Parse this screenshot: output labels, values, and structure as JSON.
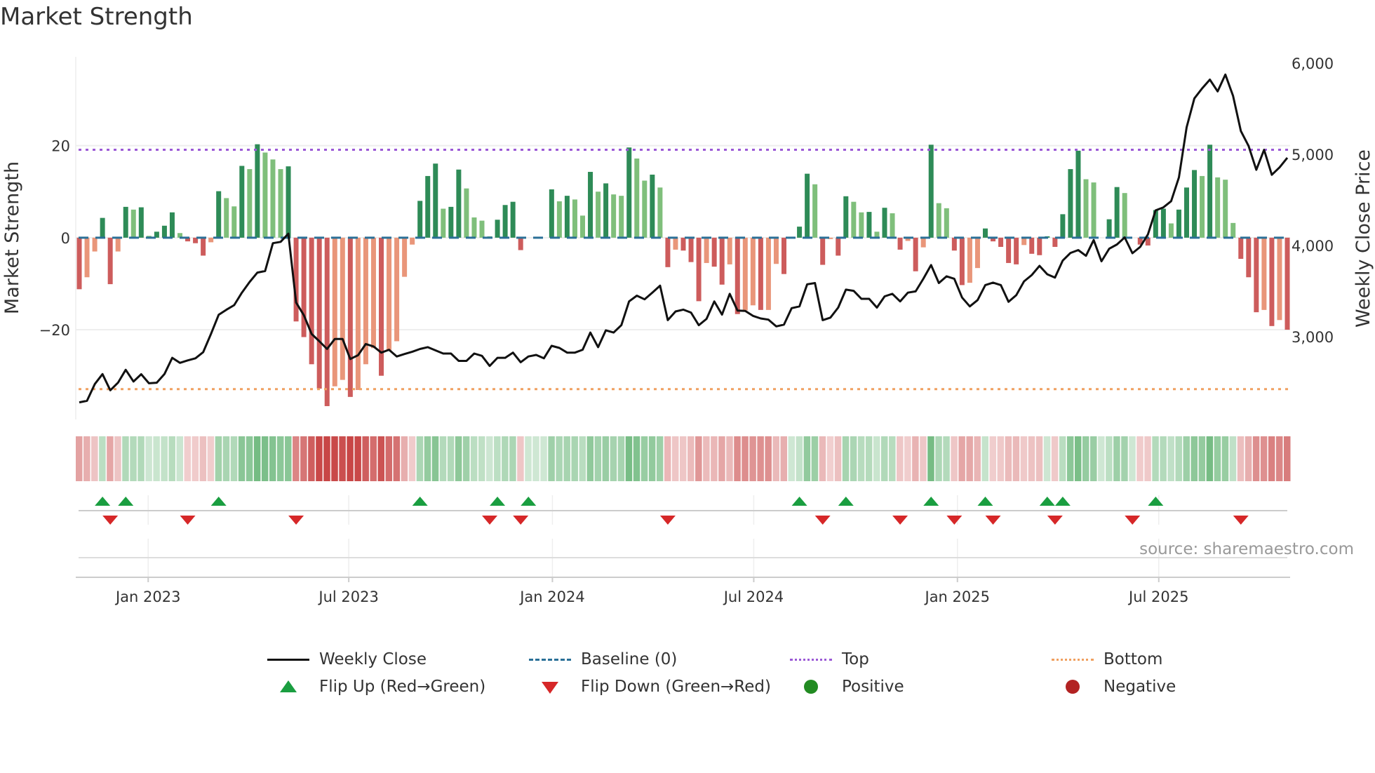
{
  "title": "Market Strength",
  "source": "source: sharemaestro.com",
  "colors": {
    "pos_up": "#2e8b57",
    "pos_down": "#7fbf7b",
    "neg_down": "#cd5c5c",
    "neg_up": "#e9967a",
    "price": "#111111",
    "baseline": "#2a6f97",
    "top": "#9b59d6",
    "bottom": "#f0a060",
    "flip_up": "#1a9e40",
    "flip_down": "#d62728",
    "positive": "#228b22",
    "negative": "#b22222"
  },
  "chart_data": {
    "type": "bar+line",
    "title": "Market Strength",
    "ylabel": "Market Strength",
    "y2label": "Weekly Close Price",
    "ylim": [
      -39.5,
      39.3
    ],
    "y2lim": [
      2092,
      6069
    ],
    "yticks": [
      {
        "v": 20,
        "label": "20"
      },
      {
        "v": 0,
        "label": "0"
      },
      {
        "v": -20,
        "label": "−20"
      }
    ],
    "y2ticks": [
      {
        "v": 6000,
        "label": "6,000"
      },
      {
        "v": 5000,
        "label": "5,000"
      },
      {
        "v": 4000,
        "label": "4,000"
      },
      {
        "v": 3000,
        "label": "3,000"
      }
    ],
    "xticks": [
      {
        "week": 8.9,
        "label": "Jan 2023"
      },
      {
        "week": 34.8,
        "label": "Jul 2023"
      },
      {
        "week": 61.1,
        "label": "Jan 2024"
      },
      {
        "week": 87.1,
        "label": "Jul 2024"
      },
      {
        "week": 113.4,
        "label": "Jan 2025"
      },
      {
        "week": 139.4,
        "label": "Jul 2025"
      }
    ],
    "x_unit": "week index (weekly)",
    "top_level": 19.1,
    "bottom_level": -32.9,
    "strength": [
      -11.2,
      -8.6,
      -3.0,
      4.3,
      -10.1,
      -3.0,
      6.7,
      6.1,
      6.6,
      0.4,
      1.3,
      2.6,
      5.5,
      1.0,
      -0.8,
      -1.2,
      -3.9,
      -1.0,
      10.1,
      8.6,
      6.8,
      15.6,
      14.9,
      20.3,
      18.5,
      17.0,
      14.9,
      15.5,
      -18.2,
      -21.6,
      -27.5,
      -32.8,
      -36.6,
      -32.3,
      -30.9,
      -34.6,
      -33.1,
      -27.5,
      -24.0,
      -30.0,
      -24.5,
      -22.5,
      -8.5,
      -1.5,
      8.0,
      13.4,
      16.1,
      6.3,
      6.7,
      14.8,
      10.7,
      4.4,
      3.7,
      0.3,
      3.9,
      7.1,
      7.8,
      -2.7,
      0,
      0,
      0,
      10.5,
      7.9,
      9.1,
      8.3,
      4.8,
      14.3,
      10.0,
      11.8,
      9.4,
      9.1,
      19.6,
      17.2,
      12.4,
      13.7,
      10.9,
      -6.4,
      -2.6,
      -2.8,
      -5.3,
      -13.8,
      -5.5,
      -6.3,
      -10.2,
      -5.8,
      -16.6,
      -15.8,
      -14.7,
      -15.7,
      -15.7,
      -5.7,
      -7.9,
      0,
      2.4,
      13.9,
      11.6,
      -5.9,
      -0.3,
      -3.9,
      9.0,
      7.8,
      5.5,
      5.6,
      1.3,
      6.5,
      5.3,
      -2.6,
      -0.7,
      -7.3,
      -2.1,
      20.2,
      7.5,
      6.4,
      -2.8,
      -10.3,
      -9.8,
      -6.6,
      2.0,
      -0.8,
      -2.0,
      -5.5,
      -5.8,
      -1.6,
      -3.5,
      -3.8,
      0.3,
      -2.0,
      5.1,
      14.9,
      18.9,
      12.7,
      12.0,
      0,
      4.0,
      11.0,
      9.7,
      0,
      -1.5,
      -1.7,
      6.0,
      6.3,
      3.1,
      6.1,
      10.9,
      14.7,
      13.4,
      20.2,
      13.1,
      12.6,
      3.2,
      -4.6,
      -8.6,
      -16.2,
      -15.7,
      -19.2,
      -17.9,
      -20.0
    ],
    "price": [
      2280,
      2297,
      2480,
      2590,
      2412,
      2495,
      2637,
      2508,
      2588,
      2489,
      2495,
      2590,
      2768,
      2713,
      2740,
      2763,
      2830,
      3030,
      3240,
      3295,
      3346,
      3483,
      3600,
      3703,
      3720,
      4025,
      4040,
      4130,
      3374,
      3236,
      3030,
      2950,
      2865,
      2975,
      2975,
      2755,
      2797,
      2920,
      2893,
      2825,
      2857,
      2783,
      2810,
      2835,
      2865,
      2885,
      2850,
      2815,
      2815,
      2734,
      2734,
      2815,
      2790,
      2679,
      2768,
      2768,
      2825,
      2720,
      2783,
      2800,
      2763,
      2900,
      2877,
      2825,
      2825,
      2857,
      3045,
      2885,
      3070,
      3045,
      3126,
      3387,
      3450,
      3410,
      3483,
      3560,
      3181,
      3277,
      3297,
      3264,
      3126,
      3195,
      3387,
      3242,
      3470,
      3286,
      3283,
      3228,
      3200,
      3187,
      3113,
      3132,
      3313,
      3332,
      3574,
      3588,
      3181,
      3209,
      3319,
      3516,
      3503,
      3415,
      3415,
      3319,
      3442,
      3470,
      3387,
      3483,
      3497,
      3635,
      3786,
      3588,
      3662,
      3635,
      3429,
      3332,
      3401,
      3566,
      3593,
      3566,
      3382,
      3456,
      3607,
      3676,
      3777,
      3684,
      3648,
      3835,
      3918,
      3950,
      3887,
      4060,
      3827,
      3964,
      4011,
      4088,
      3915,
      3984,
      4121,
      4385,
      4418,
      4486,
      4747,
      5297,
      5613,
      5723,
      5819,
      5690,
      5874,
      5640,
      5255,
      5091,
      4830,
      5049,
      4775,
      4857,
      4962
    ],
    "flip_up_weeks": [
      3,
      6,
      18,
      44,
      54,
      58,
      93,
      99,
      110,
      117,
      125,
      127,
      139
    ],
    "flip_down_weeks": [
      4,
      14,
      28,
      53,
      57,
      76,
      96,
      106,
      113,
      118,
      126,
      136,
      150
    ],
    "legend": {
      "placement": "bottom",
      "items": [
        {
          "key": "close",
          "label": "Weekly Close"
        },
        {
          "key": "baseline",
          "label": "Baseline (0)"
        },
        {
          "key": "top",
          "label": "Top"
        },
        {
          "key": "bottom",
          "label": "Bottom"
        },
        {
          "key": "flip_up",
          "label": "Flip Up (Red→Green)"
        },
        {
          "key": "flip_down",
          "label": "Flip Down (Green→Red)"
        },
        {
          "key": "positive",
          "label": "Positive"
        },
        {
          "key": "negative",
          "label": "Negative"
        }
      ]
    }
  }
}
